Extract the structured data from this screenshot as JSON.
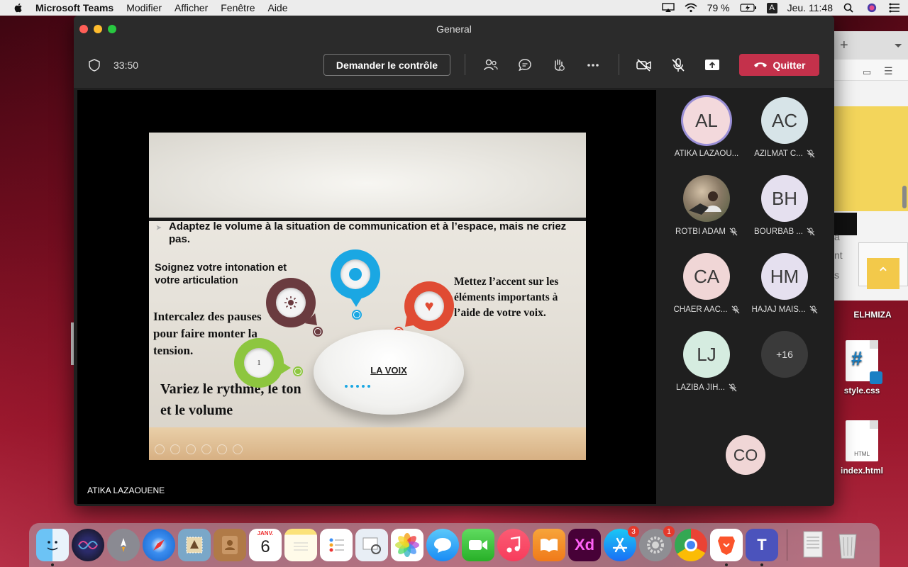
{
  "menubar": {
    "app_name": "Microsoft Teams",
    "items": [
      "Modifier",
      "Afficher",
      "Fenêtre",
      "Aide"
    ],
    "battery": "79 %",
    "input_source": "A",
    "clock": "Jeu. 11:48"
  },
  "window": {
    "title": "General"
  },
  "call": {
    "timer": "33:50",
    "request_control_label": "Demander le contrôle",
    "quit_label": "Quitter"
  },
  "slide": {
    "bullet1": "Adaptez le volume à la situation de communication et à l’espace, mais ne criez pas.",
    "intonation": "Soignez votre intonation et votre articulation",
    "pauses": "Intercalez des pauses pour faire monter la tension.",
    "accent": "Mettez l’accent  sur les éléments importants à l’aide de votre voix.",
    "rythme": "Variez le rythme, le ton et le volume",
    "center_label": "LA VOIX",
    "green_number": "1"
  },
  "presenter": {
    "name": "ATIKA LAZAOUENE"
  },
  "participants": [
    {
      "initials": "AL",
      "name": "ATIKA LAZAOU...",
      "muted": false,
      "color": "#f3d9dc"
    },
    {
      "initials": "AC",
      "name": "AZILMAT C...",
      "muted": true,
      "color": "#d7e4e8"
    },
    {
      "initials": "",
      "name": "ROTBI ADAM",
      "muted": true,
      "color": "#8a7a66"
    },
    {
      "initials": "BH",
      "name": "BOURBAB ...",
      "muted": true,
      "color": "#e5e0ef"
    },
    {
      "initials": "CA",
      "name": "CHAER AAC...",
      "muted": true,
      "color": "#f0d6d6"
    },
    {
      "initials": "HM",
      "name": "HAJAJ MAIS...",
      "muted": true,
      "color": "#e5e0ef"
    },
    {
      "initials": "LJ",
      "name": "LAZIBA JIH...",
      "muted": true,
      "color": "#d5ece0"
    }
  ],
  "more_participants": "+16",
  "self": {
    "initials": "CO"
  },
  "desktop": {
    "label_elhmiza": "ELHMIZA",
    "file_css": "style.css",
    "file_html": "index.html",
    "html_doc_label": "HTML",
    "calendar_month": "JANV.",
    "calendar_day": "6"
  },
  "dock": {
    "badges": {
      "appstore": "3",
      "settings": "1"
    }
  }
}
